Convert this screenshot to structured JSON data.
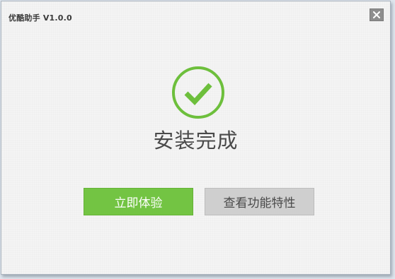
{
  "window": {
    "title": "优酷助手 V1.0.0",
    "close_icon": "close-icon"
  },
  "status": {
    "icon": "check-circle-icon",
    "message": "安装完成"
  },
  "actions": {
    "primary_label": "立即体验",
    "secondary_label": "查看功能特性"
  },
  "colors": {
    "accent_green": "#73c443",
    "check_green": "#6dbf3c",
    "secondary_gray": "#cfcfcf",
    "text_dark": "#4a4a4a"
  }
}
